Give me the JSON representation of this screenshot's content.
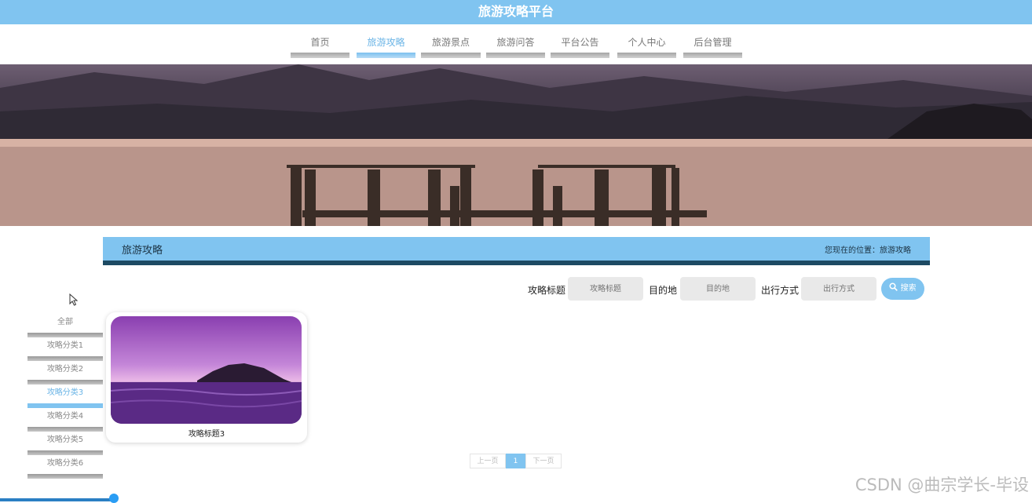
{
  "header": {
    "title": "旅游攻略平台"
  },
  "nav": {
    "items": [
      {
        "label": "首页"
      },
      {
        "label": "旅游攻略",
        "active": true
      },
      {
        "label": "旅游景点"
      },
      {
        "label": "旅游问答"
      },
      {
        "label": "平台公告"
      },
      {
        "label": "个人中心"
      },
      {
        "label": "后台管理"
      }
    ]
  },
  "section": {
    "title": "旅游攻略",
    "breadcrumb": "您现在的位置：旅游攻略"
  },
  "search": {
    "title_label": "攻略标题",
    "title_placeholder": "攻略标题",
    "dest_label": "目的地",
    "dest_placeholder": "目的地",
    "mode_label": "出行方式",
    "mode_placeholder": "出行方式",
    "button_label": "搜索"
  },
  "categories": [
    {
      "label": "全部"
    },
    {
      "label": "攻略分类1"
    },
    {
      "label": "攻略分类2"
    },
    {
      "label": "攻略分类3",
      "active": true
    },
    {
      "label": "攻略分类4"
    },
    {
      "label": "攻略分类5"
    },
    {
      "label": "攻略分类6"
    }
  ],
  "cards": [
    {
      "title": "攻略标题3"
    }
  ],
  "pagination": {
    "prev": "上一页",
    "current": "1",
    "next": "下一页"
  },
  "watermark": "CSDN @曲宗学长-毕设",
  "colors": {
    "accent": "#80c4f0",
    "dark": "#1d4a63"
  }
}
